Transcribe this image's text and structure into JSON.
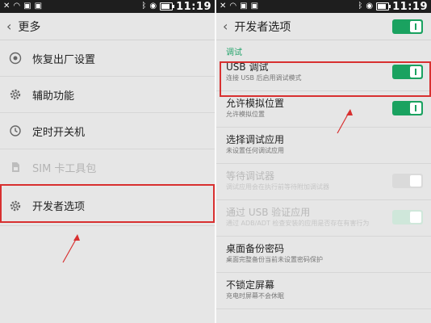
{
  "left": {
    "status": {
      "time": "11:19"
    },
    "header": {
      "back": "‹",
      "title": "更多"
    },
    "items": [
      {
        "label": "恢复出厂设置",
        "icon": "restore-icon",
        "enabled": true
      },
      {
        "label": "辅助功能",
        "icon": "gear-icon",
        "enabled": true
      },
      {
        "label": "定时开关机",
        "icon": "clock-power-icon",
        "enabled": true
      },
      {
        "label": "SIM 卡工具包",
        "icon": "sim-card-icon",
        "enabled": false
      },
      {
        "label": "开发者选项",
        "icon": "gear-icon",
        "enabled": true,
        "highlighted": true
      }
    ]
  },
  "right": {
    "status": {
      "time": "11:19"
    },
    "header": {
      "back": "‹",
      "title": "开发者选项",
      "toggle_on": true
    },
    "section": "调试",
    "items": [
      {
        "title": "USB 调试",
        "subtitle": "连接 USB 后启用调试模式",
        "toggle": "on",
        "highlighted": true
      },
      {
        "title": "允许模拟位置",
        "subtitle": "允许模拟位置",
        "toggle": "on"
      },
      {
        "title": "选择调试应用",
        "subtitle": "未设置任何调试应用",
        "toggle": null
      },
      {
        "title": "等待调试器",
        "subtitle": "调试应用会在执行前等待附加调试器",
        "toggle": "disabled-off",
        "disabled": true
      },
      {
        "title": "通过 USB 验证应用",
        "subtitle": "通过 ADB/ADT 检查安装的应用是否存在有害行为",
        "toggle": "disabled-on",
        "disabled": true
      },
      {
        "title": "桌面备份密码",
        "subtitle": "桌面完整备份当前未设置密码保护",
        "toggle": null
      },
      {
        "title": "不锁定屏幕",
        "subtitle": "充电时屏幕不会休眠",
        "toggle": null
      }
    ]
  },
  "colors": {
    "accent": "#1aa260",
    "highlight": "#d83030",
    "section": "#22a36a"
  }
}
